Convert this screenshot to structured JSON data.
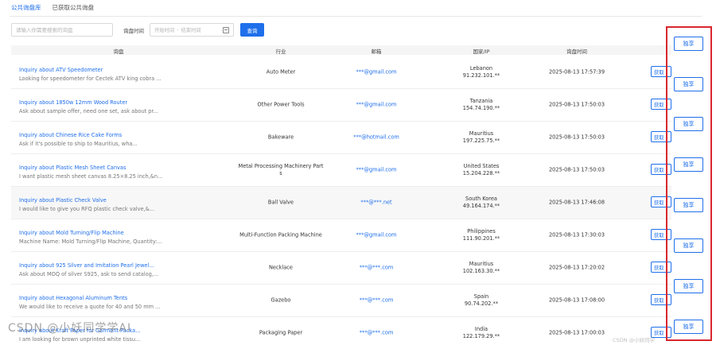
{
  "tabs": [
    {
      "label": "公共询盘库",
      "active": true
    },
    {
      "label": "已获取公共询盘",
      "active": false
    }
  ],
  "filters": {
    "search_placeholder": "请输入你需要搜索的询盘",
    "time_label": "询盘时间",
    "start_placeholder": "开始时间",
    "range_separator": "-",
    "end_placeholder": "结束时间",
    "query_label": "查询"
  },
  "columns": [
    "询盘",
    "行业",
    "邮箱",
    "国家/IP",
    "询盘时间"
  ],
  "rows": [
    {
      "title": "Inquiry about ATV Speedometer",
      "snippet": "Looking for speedometer for Cectek ATV king cobra ...",
      "industry": "Auto Meter",
      "email": "***@gmail.com",
      "country": "Lebanon",
      "ip": "91.232.101.**",
      "time": "2025-08-13 17:57:39",
      "action": "获取"
    },
    {
      "title": "Inquiry about 1850w 12mm Wood Router",
      "snippet": "Ask about sample offer, need one set, ask about pr...",
      "industry": "Other Power Tools",
      "email": "***@gmail.com",
      "country": "Tanzania",
      "ip": "154.74.190.**",
      "time": "2025-08-13 17:50:03",
      "action": "获取"
    },
    {
      "title": "Inquiry about Chinese Rice Cake Forms",
      "snippet": "Ask if it's possible to ship to Mauritius, wha...",
      "industry": "Bakeware",
      "email": "***@hotmail.com",
      "country": "Mauritius",
      "ip": "197.225.75.**",
      "time": "2025-08-13 17:50:03",
      "action": "获取"
    },
    {
      "title": "Inquiry about Plastic Mesh Sheet Canvas",
      "snippet": "I want plastic mesh sheet canvas 8.25×8.25 inch,&n...",
      "industry": "Metal Processing Machinery Part",
      "industry2": "s",
      "email": "***@gmail.com",
      "country": "United States",
      "ip": "15.204.228.**",
      "time": "2025-08-13 17:50:03",
      "action": "获取"
    },
    {
      "title": "Inquiry about Plastic Check Valve",
      "snippet": "I would like to give you RFQ plastic check valve,&...",
      "industry": "Ball Valve",
      "email": "***@***.net",
      "country": "South Korea",
      "ip": "49.164.174.**",
      "time": "2025-08-13 17:46:08",
      "action": "获取"
    },
    {
      "title": "Inquiry about Mold Turning/Flip Machine",
      "snippet": "Machine Name: Mold Turning/Flip Machine, Quantity:...",
      "industry": "Multi-Function Packing Machine",
      "email": "***@gmail.com",
      "country": "Philippines",
      "ip": "111.90.201.**",
      "time": "2025-08-13 17:30:03",
      "action": "获取"
    },
    {
      "title": "Inquiry about 925 Silver and Imitation Pearl Jewel...",
      "snippet": "Ask about MOQ of silver S925, ask to send catalog,...",
      "industry": "Necklace",
      "email": "***@***.com",
      "country": "Mauritius",
      "ip": "102.163.30.**",
      "time": "2025-08-13 17:20:02",
      "action": "获取"
    },
    {
      "title": "Inquiry about Hexagonal Aluminum Tents",
      "snippet": "We would like to receive a quote for 40 and 50 mm ...",
      "industry": "Gazebo",
      "email": "***@***.com",
      "country": "Spain",
      "ip": "90.74.202.**",
      "time": "2025-08-13 17:08:00",
      "action": "获取"
    },
    {
      "title": "Inquiry about Kraft Paper for Garment Packa...",
      "snippet": "I am looking for brown unprinted white tissu...",
      "industry": "Packaging Paper",
      "email": "***@***.com",
      "country": "India",
      "ip": "122.179.29.**",
      "time": "2025-08-13 17:00:03",
      "action": "获取"
    }
  ],
  "exclusive_label": "独享",
  "watermark": "CSDN @小妖同学学AI",
  "watermark_right": "CSDN @小妖同学"
}
